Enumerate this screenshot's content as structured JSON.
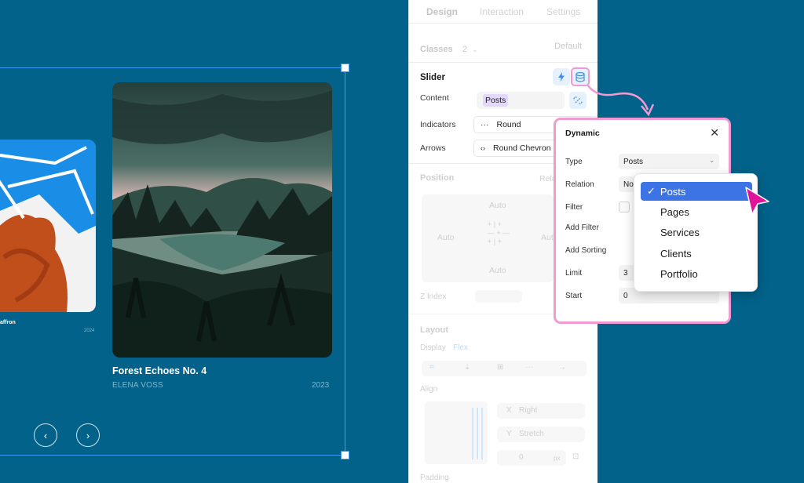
{
  "canvas": {
    "left_caption": "affron",
    "left_year": "2024",
    "artwork_title": "Forest Echoes No. 4",
    "artist": "ELENA VOSS",
    "year": "2023",
    "prev_icon": "‹",
    "next_icon": "›"
  },
  "panel": {
    "tabs": [
      "Design",
      "Interaction",
      "Settings"
    ],
    "classes_label": "Classes",
    "classes_count": "2",
    "classes_default": "Default",
    "slider_title": "Slider",
    "content_label": "Content",
    "content_value": "Posts",
    "indicators_label": "Indicators",
    "indicators_value": "Round",
    "arrows_label": "Arrows",
    "arrows_value": "Round Chevron",
    "position_label": "Position",
    "position_rel": "Rela",
    "auto_top": "Auto",
    "auto_left": "Auto",
    "auto_right": "Aut",
    "auto_bottom": "Auto",
    "z_index_label": "Z Index",
    "layout_label": "Layout",
    "display_label": "Display",
    "display_value": "Flex",
    "align_label": "Align",
    "x_label": "X",
    "x_value": "Right",
    "y_label": "Y",
    "y_value": "Stretch",
    "gap_value": "0",
    "gap_unit": "px",
    "padding_label": "Padding"
  },
  "dynamic": {
    "title": "Dynamic",
    "close": "✕",
    "type_label": "Type",
    "type_value": "Posts",
    "relation_label": "Relation",
    "relation_value": "No",
    "filter_label": "Filter",
    "add_filter_label": "Add Filter",
    "add_sorting_label": "Add Sorting",
    "limit_label": "Limit",
    "limit_value": "3",
    "start_label": "Start",
    "start_value": "0"
  },
  "dropdown": {
    "items": [
      "Posts",
      "Pages",
      "Services",
      "Clients",
      "Portfolio"
    ],
    "selected": "Posts",
    "check": "✓"
  },
  "colors": {
    "background": "#02628a",
    "selection": "#3d9cf0",
    "highlight_pink": "#f09ad1",
    "accent_blue": "#3c74e6",
    "cursor_magenta": "#e0149b"
  }
}
